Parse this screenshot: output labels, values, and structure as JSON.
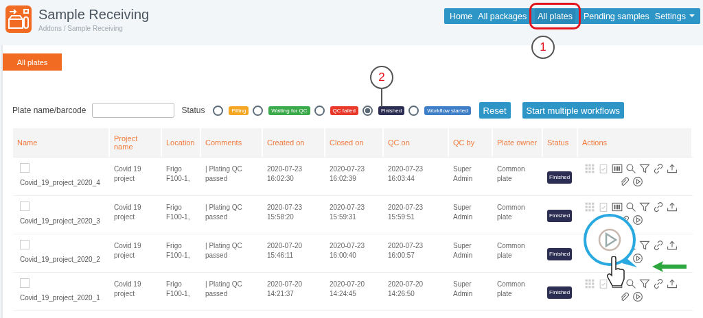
{
  "header": {
    "title": "Sample Receiving",
    "breadcrumb": "Addons / Sample Receiving"
  },
  "nav": [
    {
      "label": "Home",
      "selected": false
    },
    {
      "label": "All packages",
      "selected": false
    },
    {
      "label": "All plates",
      "selected": true
    },
    {
      "label": "Pending samples",
      "selected": false
    },
    {
      "label": "Settings",
      "selected": false,
      "kind": "dropdown"
    }
  ],
  "tabs": [
    {
      "label": "All plates",
      "selected": true
    }
  ],
  "filters": {
    "name_label": "Plate name/barcode",
    "status_label": "Status",
    "statuses": [
      {
        "label": "Filling",
        "color": "#f5a623",
        "selected": false
      },
      {
        "label": "Waiting for QC",
        "color": "#3aaa4a",
        "selected": false
      },
      {
        "label": "QC failed",
        "color": "#e8392a",
        "selected": false
      },
      {
        "label": "Finished",
        "color": "#2b2d52",
        "selected": true
      },
      {
        "label": "Workflow started",
        "color": "#3f7fc8",
        "selected": false
      }
    ],
    "buttons": [
      "Reset",
      "Start multiple workflows"
    ]
  },
  "table": {
    "columns": [
      "Name",
      "Project name",
      "Location",
      "Comments",
      "Created on",
      "Closed on",
      "QC on",
      "QC by",
      "Plate owner",
      "Status",
      "Actions"
    ],
    "rows": [
      {
        "checked": false,
        "name": "Covid_19_project_2020_4",
        "project": "Covid 19 project",
        "location": "Frigo F100-1,",
        "comments": "| Plating QC passed",
        "created": "2020-07-23 16:02:30",
        "closed": "2020-07-23 16:02:39",
        "qc_on": "2020-07-23 16:03:44",
        "qc_by": "Super Admin",
        "owner": "Common plate",
        "status": "Finished"
      },
      {
        "checked": false,
        "name": "Covid_19_project_2020_3",
        "project": "Covid 19 project",
        "location": "Frigo F100-1,",
        "comments": "| Plating QC passed",
        "created": "2020-07-23 15:58:20",
        "closed": "2020-07-23 15:59:31",
        "qc_on": "2020-07-23 15:59:51",
        "qc_by": "Super Admin",
        "owner": "Common plate",
        "status": "Finished"
      },
      {
        "checked": false,
        "name": "Covid_19_project_2020_2",
        "project": "Covid 19 project",
        "location": "Frigo F100-1,",
        "comments": "| Plating QC passed",
        "created": "2020-07-20 15:46:11",
        "closed": "2020-07-23 16:00:40",
        "qc_on": "2020-07-23 16:00:57",
        "qc_by": "Super Admin",
        "owner": "Common plate",
        "status": "Finished"
      },
      {
        "checked": false,
        "name": "Covid_19_project_2020_1",
        "project": "Covid 19 project",
        "location": "Frigo F100-1,",
        "comments": "| Plating QC passed",
        "created": "2020-07-20 14:21:37",
        "closed": "2020-07-20 14:24:45",
        "qc_on": "2020-07-20 14:26:50",
        "qc_by": "Super Admin",
        "owner": "Common plate",
        "status": "Finished"
      }
    ]
  },
  "annotations": [
    {
      "label": "1"
    },
    {
      "label": "2"
    }
  ]
}
